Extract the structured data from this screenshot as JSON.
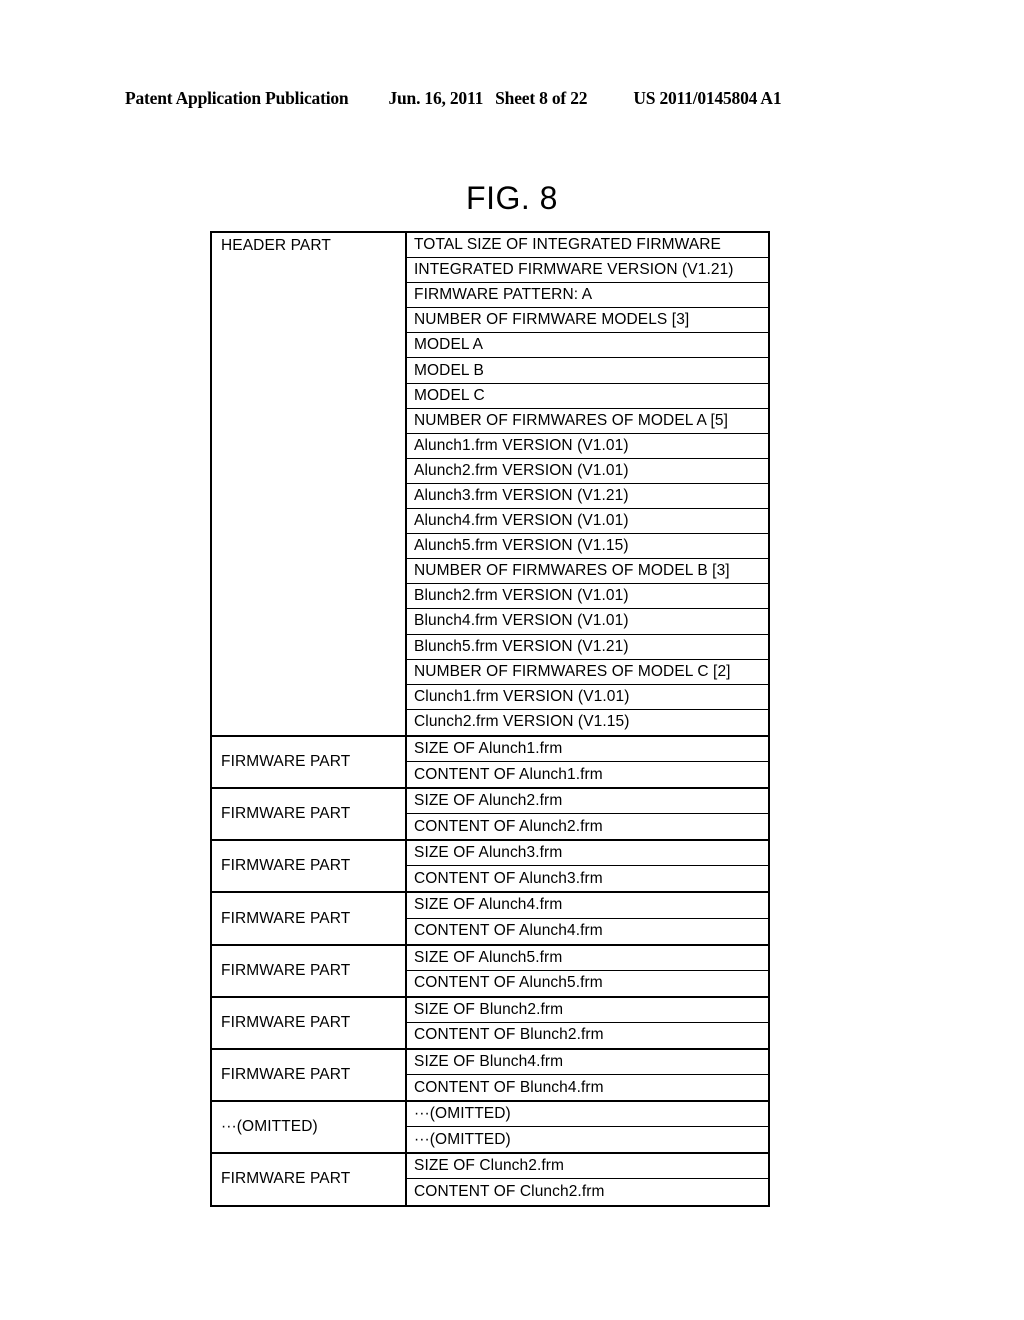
{
  "page_header": {
    "publication": "Patent Application Publication",
    "date": "Jun. 16, 2011",
    "sheet": "Sheet 8 of 22",
    "publication_number": "US 2011/0145804 A1"
  },
  "figure": {
    "title": "FIG. 8"
  },
  "table": {
    "blocks": [
      {
        "label": "HEADER PART",
        "label_align": "top",
        "rows": [
          "TOTAL SIZE OF INTEGRATED FIRMWARE",
          "INTEGRATED FIRMWARE VERSION (V1.21)",
          "FIRMWARE PATTERN: A",
          "NUMBER OF FIRMWARE MODELS [3]",
          "MODEL A",
          "MODEL B",
          "MODEL C",
          "NUMBER OF FIRMWARES OF MODEL A [5]",
          "Alunch1.frm VERSION (V1.01)",
          "Alunch2.frm VERSION (V1.01)",
          "Alunch3.frm VERSION (V1.21)",
          "Alunch4.frm VERSION (V1.01)",
          "Alunch5.frm VERSION (V1.15)",
          "NUMBER OF FIRMWARES OF MODEL B [3]",
          "Blunch2.frm VERSION (V1.01)",
          "Blunch4.frm VERSION (V1.01)",
          "Blunch5.frm VERSION (V1.21)",
          "NUMBER OF FIRMWARES OF MODEL C [2]",
          "Clunch1.frm VERSION (V1.01)",
          "Clunch2.frm VERSION (V1.15)"
        ]
      },
      {
        "label": "FIRMWARE PART",
        "label_align": "center",
        "rows": [
          "SIZE OF Alunch1.frm",
          "CONTENT OF Alunch1.frm"
        ]
      },
      {
        "label": "FIRMWARE PART",
        "label_align": "center",
        "rows": [
          "SIZE OF Alunch2.frm",
          "CONTENT OF Alunch2.frm"
        ]
      },
      {
        "label": "FIRMWARE PART",
        "label_align": "center",
        "rows": [
          "SIZE OF Alunch3.frm",
          "CONTENT OF Alunch3.frm"
        ]
      },
      {
        "label": "FIRMWARE PART",
        "label_align": "center",
        "rows": [
          "SIZE OF Alunch4.frm",
          "CONTENT OF Alunch4.frm"
        ]
      },
      {
        "label": "FIRMWARE PART",
        "label_align": "center",
        "rows": [
          "SIZE OF Alunch5.frm",
          "CONTENT OF Alunch5.frm"
        ]
      },
      {
        "label": "FIRMWARE PART",
        "label_align": "center",
        "rows": [
          "SIZE OF Blunch2.frm",
          "CONTENT OF Blunch2.frm"
        ]
      },
      {
        "label": "FIRMWARE PART",
        "label_align": "center",
        "rows": [
          "SIZE OF Blunch4.frm",
          "CONTENT OF Blunch4.frm"
        ]
      },
      {
        "label": "···(OMITTED)",
        "label_align": "center",
        "rows": [
          "···(OMITTED)",
          "···(OMITTED)"
        ]
      },
      {
        "label": "FIRMWARE PART",
        "label_align": "center",
        "rows": [
          "SIZE OF Clunch2.frm",
          "CONTENT OF Clunch2.frm"
        ]
      }
    ]
  }
}
